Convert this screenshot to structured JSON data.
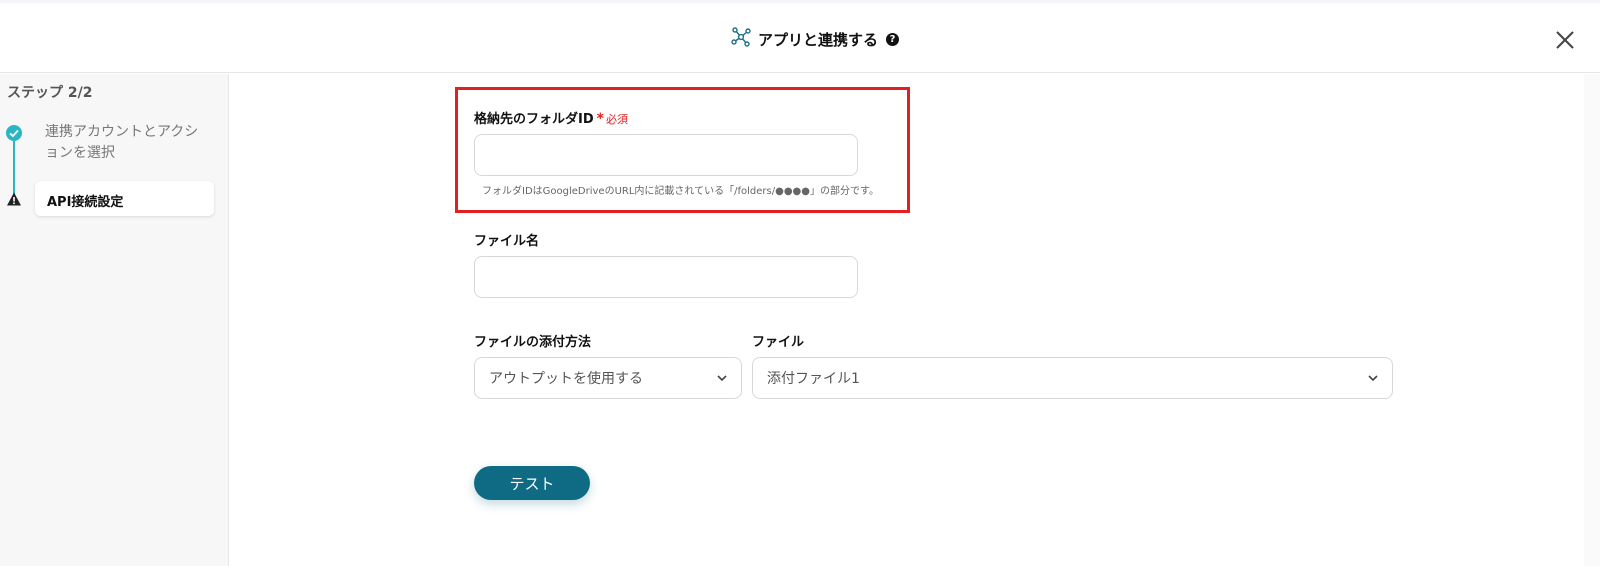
{
  "header": {
    "title": "アプリと連携する",
    "help_glyph": "?"
  },
  "sidebar": {
    "step_label": "ステップ 2/2",
    "steps": [
      {
        "label": "連携アカウントとアクションを選択",
        "status": "done"
      },
      {
        "label": "API接続設定",
        "status": "warning"
      }
    ]
  },
  "form": {
    "folder_id": {
      "label": "格納先のフォルダID",
      "required_mark": "*",
      "required_text": "必須",
      "value": "",
      "hint": "フォルダIDはGoogleDriveのURL内に記載されている「/folders/●●●●」の部分です。"
    },
    "file_name": {
      "label": "ファイル名",
      "value": ""
    },
    "attach_method": {
      "label": "ファイルの添付方法",
      "selected": "アウトプットを使用する"
    },
    "file": {
      "label": "ファイル",
      "selected": "添付ファイル1"
    },
    "test_button": "テスト"
  },
  "colors": {
    "accent": "#0f6a84",
    "step_done": "#2bb5c4",
    "highlight": "#e32020"
  }
}
